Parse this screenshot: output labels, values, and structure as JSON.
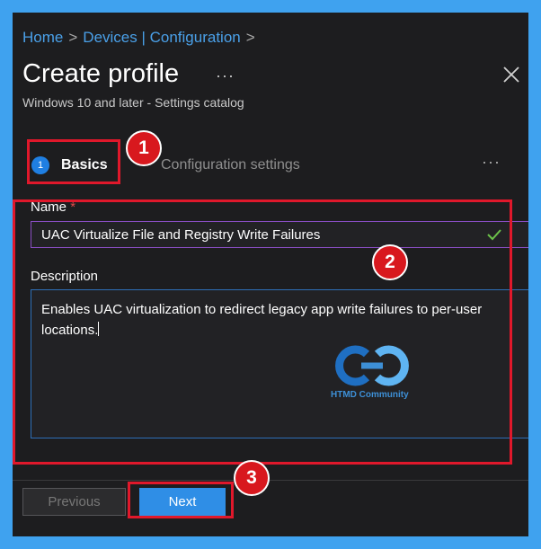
{
  "breadcrumb": {
    "home": "Home",
    "sep1": ">",
    "section": "Devices | Configuration",
    "sep2": ">"
  },
  "header": {
    "title": "Create profile",
    "more": "···",
    "subtitle": "Windows 10 and later - Settings catalog"
  },
  "steps": {
    "step1_number": "1",
    "step1_label": "Basics",
    "step2_label": "Configuration settings",
    "more": "···"
  },
  "form": {
    "name_label": "Name",
    "required_marker": "*",
    "name_value": "UAC Virtualize File and Registry Write Failures",
    "description_label": "Description",
    "description_value": "Enables UAC virtualization to redirect legacy app write failures to per-user locations."
  },
  "watermark": {
    "text": "HTMD Community"
  },
  "footer": {
    "previous_label": "Previous",
    "next_label": "Next"
  },
  "annotations": {
    "marker1": "1",
    "marker2": "2",
    "marker3": "3"
  },
  "colors": {
    "accent": "#2f8ee6",
    "link": "#4aa0e8",
    "annotation_red": "#e0182b",
    "background": "#3fa2ef"
  },
  "icons": {
    "close": "close-icon",
    "check": "checkmark-icon",
    "logo": "htmd-logo"
  }
}
